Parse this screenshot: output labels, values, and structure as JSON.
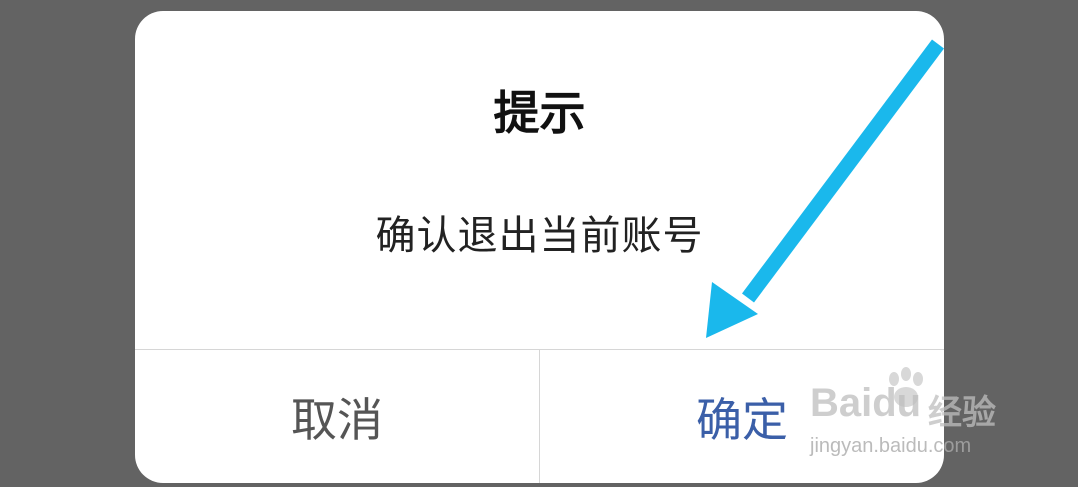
{
  "dialog": {
    "title": "提示",
    "message": "确认退出当前账号",
    "cancel_label": "取消",
    "confirm_label": "确定"
  },
  "annotation": {
    "arrow_color": "#1ab8ec",
    "arrow_icon": "arrow-pointing-to-confirm-icon"
  },
  "watermark": {
    "brand_text": "Baidu",
    "brand_cn": "经验",
    "url": "jingyan.baidu.com"
  },
  "colors": {
    "backdrop": "#636363",
    "dialog_bg": "#ffffff",
    "confirm_text": "#3b5fa8",
    "cancel_text": "#555555"
  }
}
